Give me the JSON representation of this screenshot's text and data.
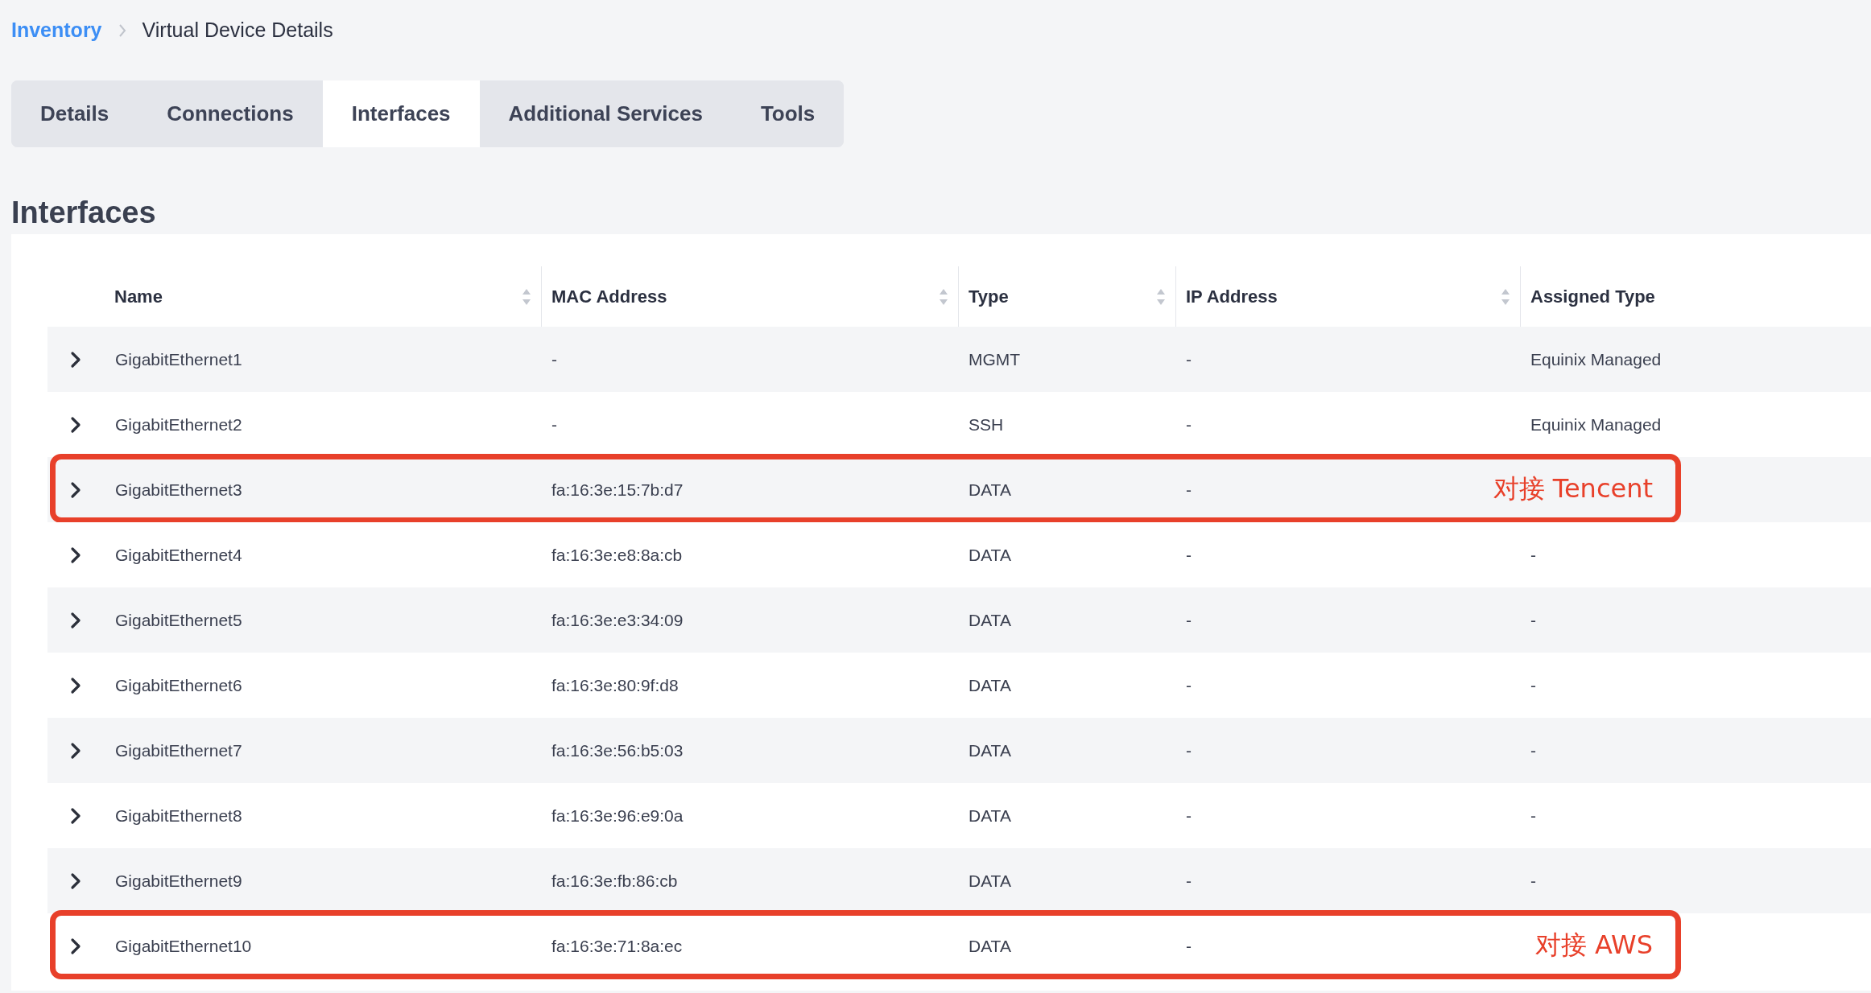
{
  "breadcrumb": {
    "link": "Inventory",
    "current": "Virtual Device Details"
  },
  "tabs": [
    {
      "label": "Details",
      "selected": false
    },
    {
      "label": "Connections",
      "selected": false
    },
    {
      "label": "Interfaces",
      "selected": true
    },
    {
      "label": "Additional Services",
      "selected": false
    },
    {
      "label": "Tools",
      "selected": false
    }
  ],
  "section_title": "Interfaces",
  "table": {
    "columns": [
      {
        "label": "Name",
        "sortable": true
      },
      {
        "label": "MAC Address",
        "sortable": true
      },
      {
        "label": "Type",
        "sortable": true
      },
      {
        "label": "IP Address",
        "sortable": true
      },
      {
        "label": "Assigned Type",
        "sortable": false
      }
    ],
    "rows": [
      {
        "name": "GigabitEthernet1",
        "mac": "-",
        "type": "MGMT",
        "ip": "-",
        "assigned_type": "Equinix Managed"
      },
      {
        "name": "GigabitEthernet2",
        "mac": "-",
        "type": "SSH",
        "ip": "-",
        "assigned_type": "Equinix Managed"
      },
      {
        "name": "GigabitEthernet3",
        "mac": "fa:16:3e:15:7b:d7",
        "type": "DATA",
        "ip": "-",
        "annotation": "对接 Tencent"
      },
      {
        "name": "GigabitEthernet4",
        "mac": "fa:16:3e:e8:8a:cb",
        "type": "DATA",
        "ip": "-",
        "assigned_type": "-"
      },
      {
        "name": "GigabitEthernet5",
        "mac": "fa:16:3e:e3:34:09",
        "type": "DATA",
        "ip": "-",
        "assigned_type": "-"
      },
      {
        "name": "GigabitEthernet6",
        "mac": "fa:16:3e:80:9f:d8",
        "type": "DATA",
        "ip": "-",
        "assigned_type": "-"
      },
      {
        "name": "GigabitEthernet7",
        "mac": "fa:16:3e:56:b5:03",
        "type": "DATA",
        "ip": "-",
        "assigned_type": "-"
      },
      {
        "name": "GigabitEthernet8",
        "mac": "fa:16:3e:96:e9:0a",
        "type": "DATA",
        "ip": "-",
        "assigned_type": "-"
      },
      {
        "name": "GigabitEthernet9",
        "mac": "fa:16:3e:fb:86:cb",
        "type": "DATA",
        "ip": "-",
        "assigned_type": "-"
      },
      {
        "name": "GigabitEthernet10",
        "mac": "fa:16:3e:71:8a:ec",
        "type": "DATA",
        "ip": "-",
        "annotation": "对接 AWS"
      }
    ]
  }
}
